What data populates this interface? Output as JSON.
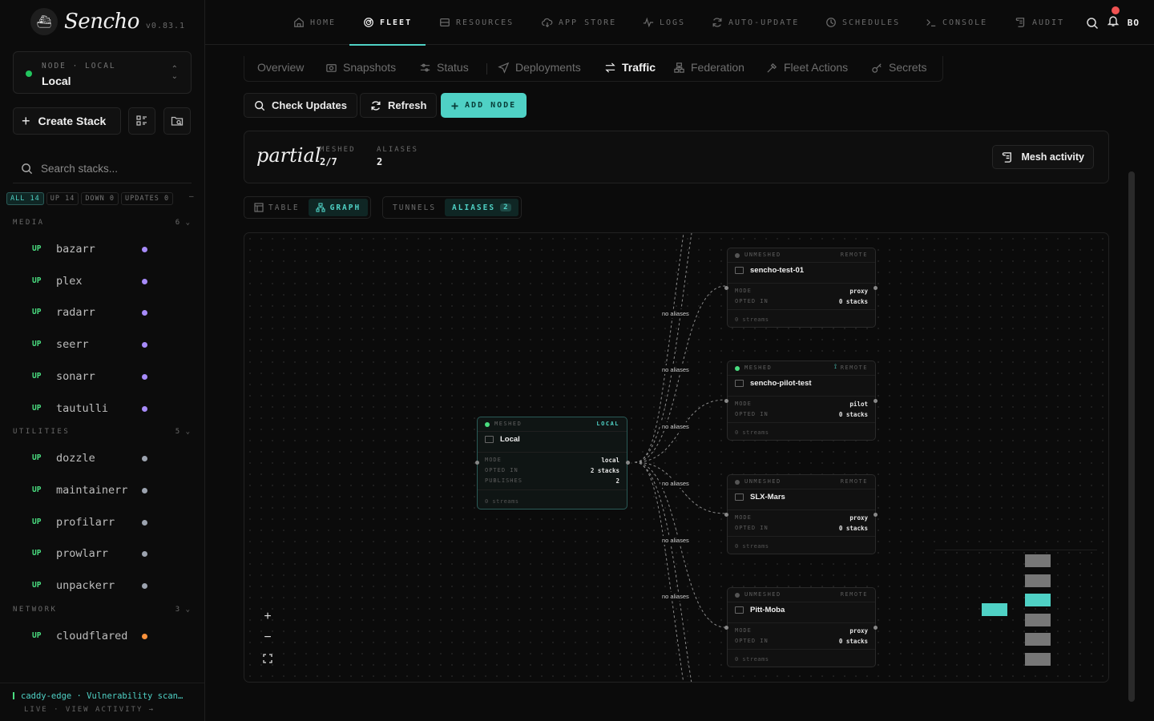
{
  "app": {
    "name": "Sencho",
    "version": "v0.83.1"
  },
  "node_selector": {
    "caption": "NODE · LOCAL",
    "name": "Local"
  },
  "sidebar": {
    "create_label": "Create Stack",
    "search_placeholder": "Search stacks...",
    "filters": [
      "ALL 14",
      "UP 14",
      "DOWN 0",
      "UPDATES 0"
    ],
    "groups": [
      {
        "name": "MEDIA",
        "count": "6",
        "stacks": [
          {
            "status": "UP",
            "name": "bazarr",
            "color": "#a78bfa"
          },
          {
            "status": "UP",
            "name": "plex",
            "color": "#a78bfa"
          },
          {
            "status": "UP",
            "name": "radarr",
            "color": "#a78bfa"
          },
          {
            "status": "UP",
            "name": "seerr",
            "color": "#a78bfa"
          },
          {
            "status": "UP",
            "name": "sonarr",
            "color": "#a78bfa"
          },
          {
            "status": "UP",
            "name": "tautulli",
            "color": "#a78bfa"
          }
        ]
      },
      {
        "name": "UTILITIES",
        "count": "5",
        "stacks": [
          {
            "status": "UP",
            "name": "dozzle",
            "color": "#9ca3af"
          },
          {
            "status": "UP",
            "name": "maintainerr",
            "color": "#9ca3af"
          },
          {
            "status": "UP",
            "name": "profilarr",
            "color": "#9ca3af"
          },
          {
            "status": "UP",
            "name": "prowlarr",
            "color": "#9ca3af"
          },
          {
            "status": "UP",
            "name": "unpackerr",
            "color": "#9ca3af"
          }
        ]
      },
      {
        "name": "NETWORK",
        "count": "3",
        "stacks": [
          {
            "status": "UP",
            "name": "cloudflared",
            "color": "#fb923c"
          }
        ]
      }
    ],
    "footer": {
      "line1": "caddy-edge · Vulnerability scan…",
      "line2": "LIVE · VIEW ACTIVITY →"
    }
  },
  "nav": {
    "items": [
      "HOME",
      "FLEET",
      "RESOURCES",
      "APP STORE",
      "LOGS",
      "AUTO-UPDATE",
      "SCHEDULES",
      "CONSOLE",
      "AUDIT"
    ],
    "active": "FLEET",
    "user": "BO"
  },
  "fleet": {
    "tabs": [
      "Overview",
      "Snapshots",
      "Status",
      "Deployments",
      "Traffic",
      "Federation",
      "Fleet Actions",
      "Secrets"
    ],
    "active_tab": "Traffic",
    "actions": {
      "check": "Check Updates",
      "refresh": "Refresh",
      "add": "ADD NODE"
    },
    "status": {
      "state": "partial",
      "meshed_label": "MESHED",
      "meshed": "2/7",
      "aliases_label": "ALIASES",
      "aliases": "2",
      "mesh_activity": "Mesh activity"
    },
    "view_toggle": {
      "table": "TABLE",
      "graph": "GRAPH"
    },
    "mode_toggle": {
      "tunnels": "TUNNELS",
      "aliases": "ALIASES",
      "aliases_count": "2"
    }
  },
  "graph": {
    "local": {
      "state": "MESHED",
      "tag": "LOCAL",
      "name": "Local",
      "mode_label": "MODE",
      "mode": "local",
      "opted_label": "OPTED IN",
      "opted": "2 stacks",
      "publishes_label": "PUBLISHES",
      "publishes": "2",
      "streams": "0 streams"
    },
    "remotes": [
      {
        "state": "UNMESHED",
        "tag": "REMOTE",
        "name": "sencho-test-01",
        "mode": "proxy",
        "opted": "0 stacks",
        "streams": "0 streams"
      },
      {
        "state": "MESHED",
        "tag": "REMOTE",
        "name": "sencho-pilot-test",
        "mode": "pilot",
        "opted": "0 stacks",
        "streams": "0 streams"
      },
      {
        "state": "UNMESHED",
        "tag": "REMOTE",
        "name": "SLX-Mars",
        "mode": "proxy",
        "opted": "0 stacks",
        "streams": "0 streams"
      },
      {
        "state": "UNMESHED",
        "tag": "REMOTE",
        "name": "Pitt-Moba",
        "mode": "proxy",
        "opted": "0 stacks",
        "streams": "0 streams"
      }
    ],
    "edge_label": "no aliases",
    "labels": {
      "mode": "MODE",
      "opted": "OPTED IN"
    }
  }
}
